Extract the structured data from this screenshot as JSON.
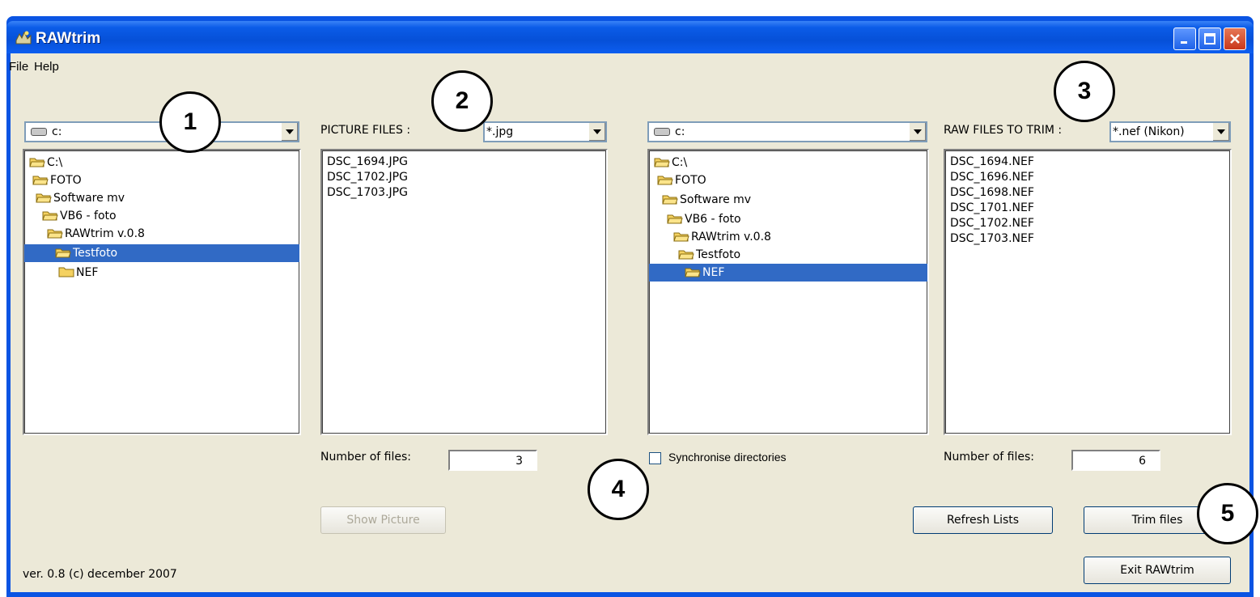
{
  "window": {
    "title": "RAWtrim"
  },
  "menu": {
    "items": [
      "File",
      "Help"
    ]
  },
  "left_drive": {
    "value": "c:"
  },
  "left_tree": [
    {
      "label": "C:\\",
      "selected": false
    },
    {
      "label": "FOTO",
      "selected": false
    },
    {
      "label": "Software mv",
      "selected": false
    },
    {
      "label": "VB6 - foto",
      "selected": false
    },
    {
      "label": "RAWtrim v.0.8",
      "selected": false
    },
    {
      "label": "Testfoto",
      "selected": true
    },
    {
      "label": "NEF",
      "selected": false
    }
  ],
  "picture_files": {
    "label": "PICTURE FILES :",
    "filter": "*.jpg",
    "files": [
      "DSC_1694.JPG",
      "DSC_1702.JPG",
      "DSC_1703.JPG"
    ],
    "count_label": "Number of files:",
    "count": "3"
  },
  "right_drive": {
    "value": "c:"
  },
  "right_tree": [
    {
      "label": "C:\\",
      "selected": false
    },
    {
      "label": "FOTO",
      "selected": false
    },
    {
      "label": "Software mv",
      "selected": false
    },
    {
      "label": "VB6 - foto",
      "selected": false
    },
    {
      "label": "RAWtrim v.0.8",
      "selected": false
    },
    {
      "label": "Testfoto",
      "selected": false
    },
    {
      "label": "NEF",
      "selected": true
    }
  ],
  "raw_files": {
    "label": "RAW FILES TO TRIM :",
    "filter": "*.nef (Nikon)",
    "files": [
      "DSC_1694.NEF",
      "DSC_1696.NEF",
      "DSC_1698.NEF",
      "DSC_1701.NEF",
      "DSC_1702.NEF",
      "DSC_1703.NEF"
    ],
    "count_label": "Number of files:",
    "count": "6"
  },
  "sync": {
    "label": "Synchronise directories",
    "checked": false
  },
  "buttons": {
    "show_picture": "Show Picture",
    "refresh": "Refresh Lists",
    "trim": "Trim files",
    "exit": "Exit RAWtrim"
  },
  "status": {
    "version": "ver. 0.8 (c) december 2007"
  },
  "callouts": [
    "1",
    "2",
    "3",
    "4",
    "5"
  ]
}
